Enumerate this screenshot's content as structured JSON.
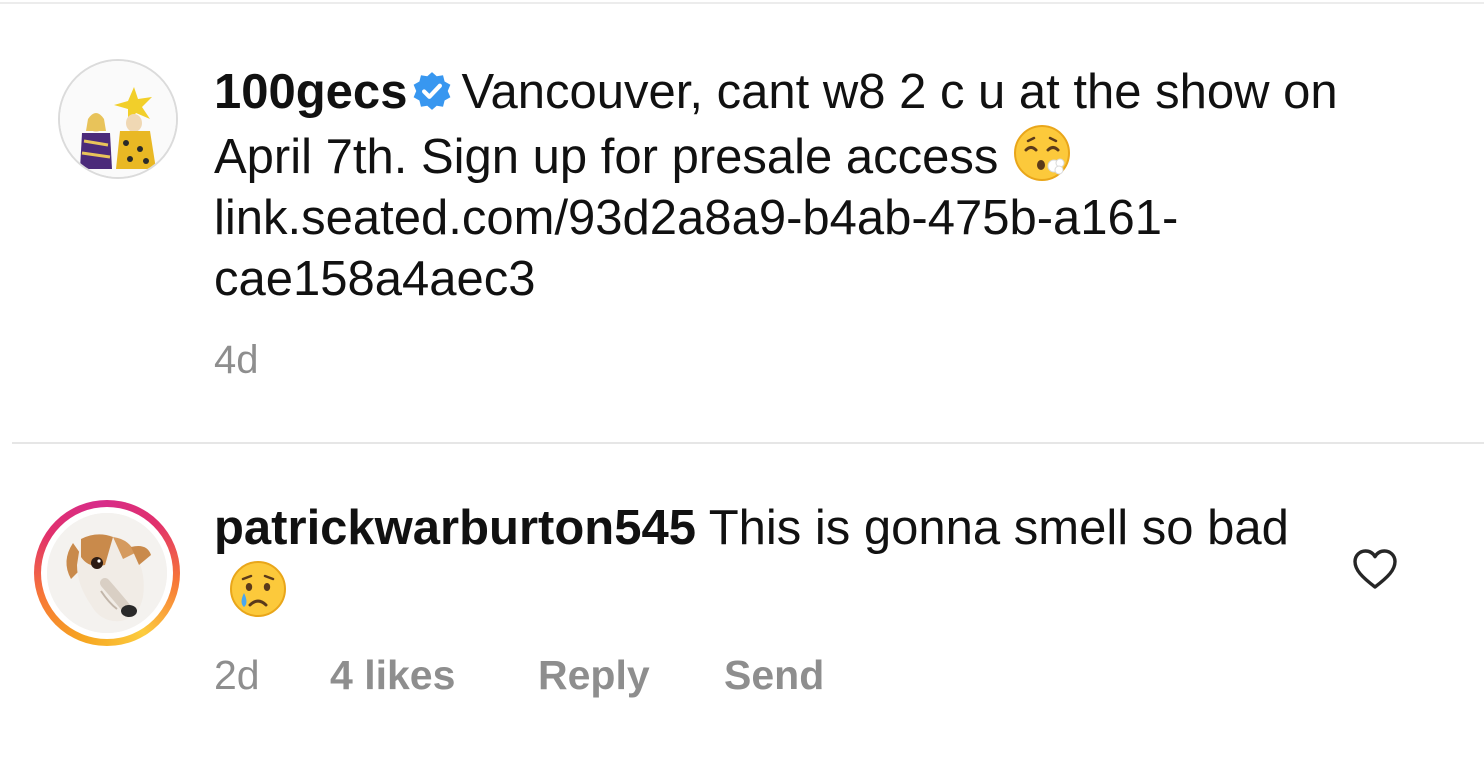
{
  "post_caption": {
    "username": "100gecs",
    "verified": true,
    "text": "Vancouver, cant w8 2 c u at the show on April 7th. Sign up for presale access",
    "link": "link.seated.com/93d2a8a9-b4ab-475b-a161-cae158a4aec3",
    "emoji": "face-exhaling-emoji",
    "time_ago": "4d"
  },
  "comment": {
    "username": "patrickwarburton545",
    "text": "This is gonna smell so bad",
    "emoji": "crying-face-emoji",
    "time_ago": "2d",
    "likes": "4 likes",
    "reply_label": "Reply",
    "send_label": "Send",
    "like_icon": "heart-outline-icon"
  },
  "colors": {
    "verified_badge": "#3897f0",
    "secondary_text": "#8e8e8e",
    "story_ring_start": "#f6a521",
    "story_ring_end": "#d72c8a"
  }
}
